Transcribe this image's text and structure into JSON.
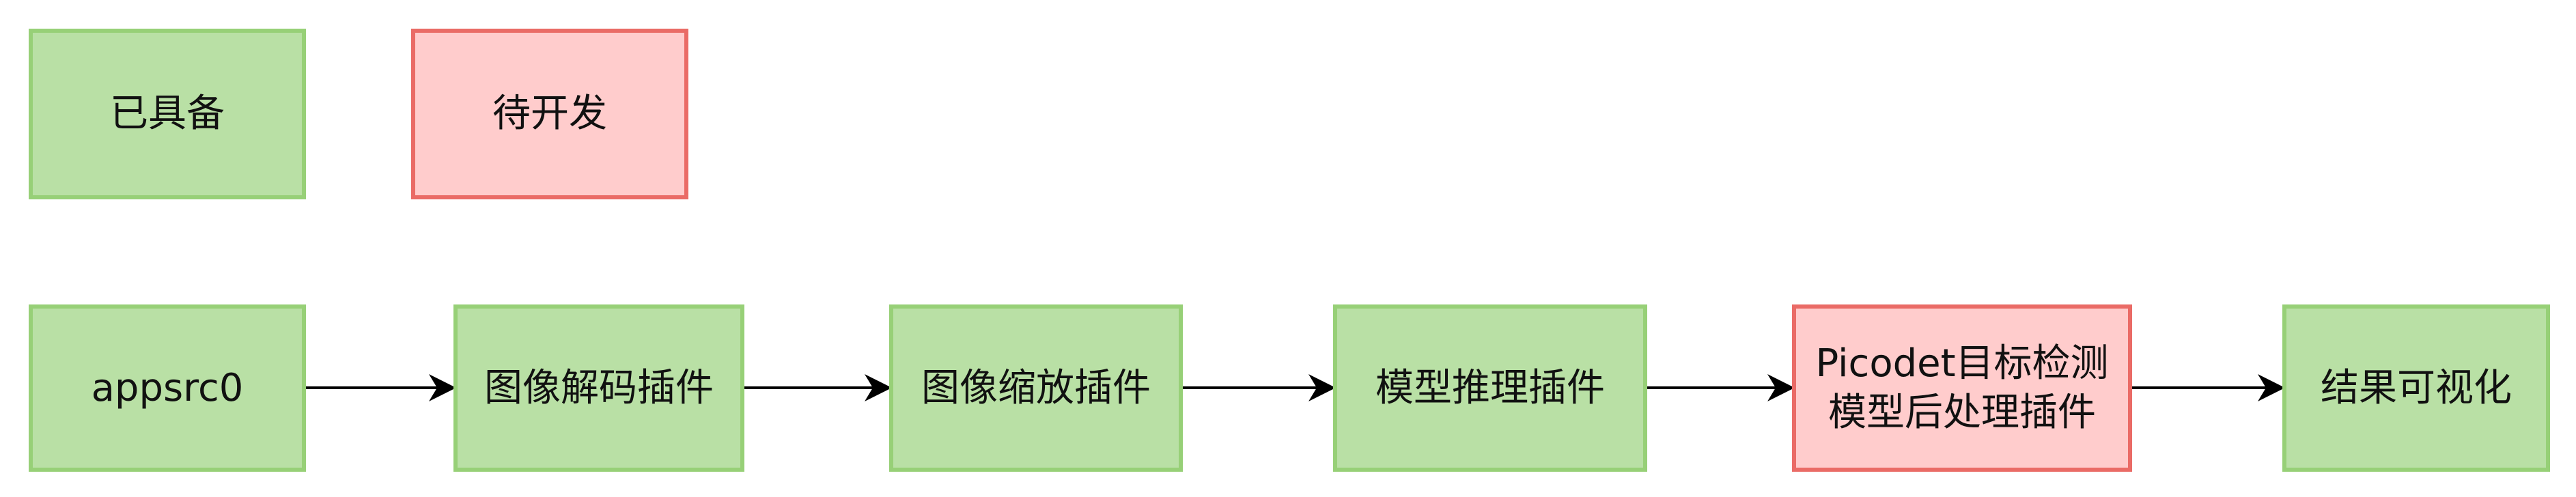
{
  "legend": {
    "ready": "已具备",
    "todo": "待开发"
  },
  "nodes": [
    {
      "id": "appsrc0",
      "label": "appsrc0",
      "status": "ready"
    },
    {
      "id": "image-decode",
      "label": "图像解码插件",
      "status": "ready"
    },
    {
      "id": "image-resize",
      "label": "图像缩放插件",
      "status": "ready"
    },
    {
      "id": "model-infer",
      "label": "模型推理插件",
      "status": "ready"
    },
    {
      "id": "picodet-postprocess",
      "label": "Picodet目标检测模型后处理插件",
      "status": "todo"
    },
    {
      "id": "result-visualize",
      "label": "结果可视化",
      "status": "ready"
    }
  ],
  "edges": [
    {
      "from": "appsrc0",
      "to": "image-decode"
    },
    {
      "from": "image-decode",
      "to": "image-resize"
    },
    {
      "from": "image-resize",
      "to": "model-infer"
    },
    {
      "from": "model-infer",
      "to": "picodet-postprocess"
    },
    {
      "from": "picodet-postprocess",
      "to": "result-visualize"
    }
  ],
  "colors": {
    "ready_fill": "#b9e0a5",
    "ready_stroke": "#97d077",
    "todo_fill": "#ffcccc",
    "todo_stroke": "#ea6b66",
    "edge": "#000000"
  }
}
